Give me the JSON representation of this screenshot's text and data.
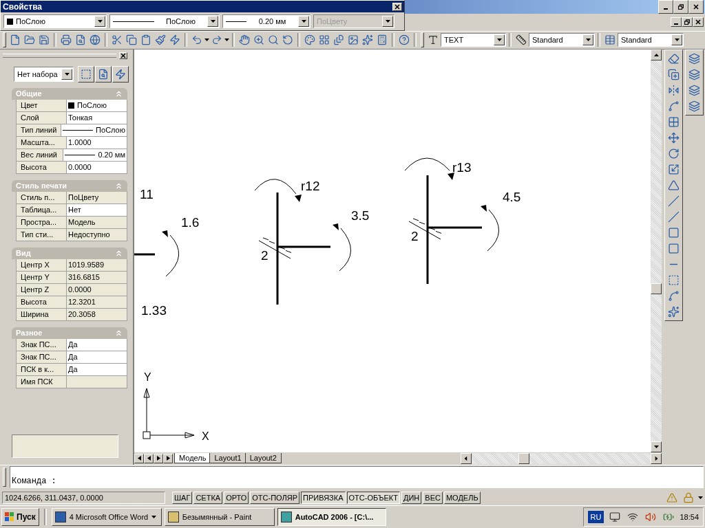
{
  "properties_toolbar": {
    "title": "Свойства",
    "combos": [
      {
        "kind": "color",
        "value": "ПоСлою",
        "disabled": false
      },
      {
        "kind": "line",
        "value": "ПоСлою",
        "disabled": false
      },
      {
        "kind": "line",
        "value": "0.20 мм",
        "disabled": false
      },
      {
        "kind": "text",
        "value": "ПоЦвету",
        "disabled": true
      }
    ]
  },
  "style_toolbar": {
    "text_style": "TEXT",
    "dim_style": "Standard",
    "table_style": "Standard"
  },
  "palette": {
    "selection": "Нет набора",
    "sections": [
      {
        "title": "Общие",
        "expanded": true,
        "rows": [
          {
            "label": "Цвет",
            "value": "ПоСлою",
            "kind": "color",
            "readonly": false
          },
          {
            "label": "Слой",
            "value": "Тонкая",
            "kind": "text",
            "readonly": false
          },
          {
            "label": "Тип линий",
            "value": "ПоСлою",
            "kind": "line",
            "readonly": false
          },
          {
            "label": "Масшта...",
            "value": "1.0000",
            "kind": "text",
            "readonly": false
          },
          {
            "label": "Вес линий",
            "value": "0.20 мм",
            "kind": "line",
            "readonly": false
          },
          {
            "label": "Высота",
            "value": "0.0000",
            "kind": "text",
            "readonly": false
          }
        ]
      },
      {
        "title": "Стиль печати",
        "expanded": true,
        "rows": [
          {
            "label": "Стиль п...",
            "value": "ПоЦвету",
            "kind": "text",
            "readonly": true
          },
          {
            "label": "Таблица...",
            "value": "Нет",
            "kind": "text",
            "readonly": false
          },
          {
            "label": "Простра...",
            "value": "Модель",
            "kind": "text",
            "readonly": true
          },
          {
            "label": "Тип сти...",
            "value": "Недоступно",
            "kind": "text",
            "readonly": true
          }
        ]
      },
      {
        "title": "Вид",
        "expanded": true,
        "rows": [
          {
            "label": "Центр X",
            "value": "1019.9589",
            "kind": "text",
            "readonly": true
          },
          {
            "label": "Центр Y",
            "value": "316.6815",
            "kind": "text",
            "readonly": true
          },
          {
            "label": "Центр Z",
            "value": "0.0000",
            "kind": "text",
            "readonly": true
          },
          {
            "label": "Высота",
            "value": "12.3201",
            "kind": "text",
            "readonly": true
          },
          {
            "label": "Ширина",
            "value": "20.3058",
            "kind": "text",
            "readonly": true
          }
        ]
      },
      {
        "title": "Разное",
        "expanded": true,
        "rows": [
          {
            "label": "Знак ПС...",
            "value": "Да",
            "kind": "text",
            "readonly": false
          },
          {
            "label": "Знак ПС...",
            "value": "Да",
            "kind": "text",
            "readonly": false
          },
          {
            "label": "ПСК в к...",
            "value": "Да",
            "kind": "text",
            "readonly": false
          },
          {
            "label": "Имя ПСК",
            "kind": "text",
            "readonly": true
          }
        ]
      }
    ]
  },
  "drawing": {
    "labels": [
      "11",
      "1.6",
      "1.33",
      "r12",
      "2",
      "3.5",
      "r13",
      "2",
      "4.5"
    ],
    "ucs_axes": [
      "Y",
      "X"
    ]
  },
  "layout_tabs": [
    {
      "label": "Модель",
      "selected": true
    },
    {
      "label": "Layout1",
      "selected": false
    },
    {
      "label": "Layout2",
      "selected": false
    }
  ],
  "command_line": {
    "prompt": "Команда :"
  },
  "status_bar": {
    "coordinates": "1024.6266, 311.0437, 0.0000",
    "toggles": [
      {
        "label": "ШАГ",
        "on": false
      },
      {
        "label": "СЕТКА",
        "on": false
      },
      {
        "label": "ОРТО",
        "on": false
      },
      {
        "label": "ОТС-ПОЛЯР",
        "on": false
      },
      {
        "label": "ПРИВЯЗКА",
        "on": true
      },
      {
        "label": "ОТС-ОБЪЕКТ",
        "on": true
      },
      {
        "label": "ДИН",
        "on": false
      },
      {
        "label": "ВЕС",
        "on": false
      },
      {
        "label": "МОДЕЛЬ",
        "on": false
      }
    ]
  },
  "taskbar": {
    "start": "Пуск",
    "tasks": [
      {
        "label": "4 Microsoft Office Word",
        "kind": "group",
        "selected": false
      },
      {
        "label": "Безымянный - Paint",
        "kind": "window",
        "selected": false
      },
      {
        "label": "AutoCAD 2006 - [C:\\...",
        "kind": "window",
        "selected": true
      }
    ],
    "language": "RU",
    "clock": "18:54"
  }
}
